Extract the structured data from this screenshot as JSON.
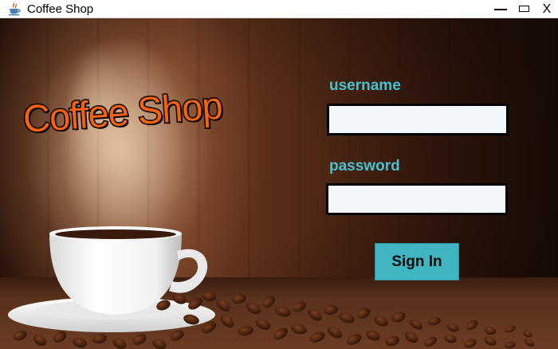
{
  "window": {
    "title": "Coffee Shop",
    "app_icon": "java-cup-icon",
    "controls": {
      "minimize_icon": "minimize-icon",
      "maximize_icon": "maximize-icon",
      "close_label": "X"
    }
  },
  "branding": {
    "logo_text": "Coffee Shop",
    "logo_color": "#f5620f"
  },
  "login_form": {
    "username_label": "username",
    "username_value": "",
    "password_label": "password",
    "password_value": "",
    "sign_in_label": "Sign In",
    "label_color": "#46c2cf",
    "button_color": "#40b5c2"
  },
  "background": {
    "scene": "coffee-cup-and-beans-photo"
  }
}
